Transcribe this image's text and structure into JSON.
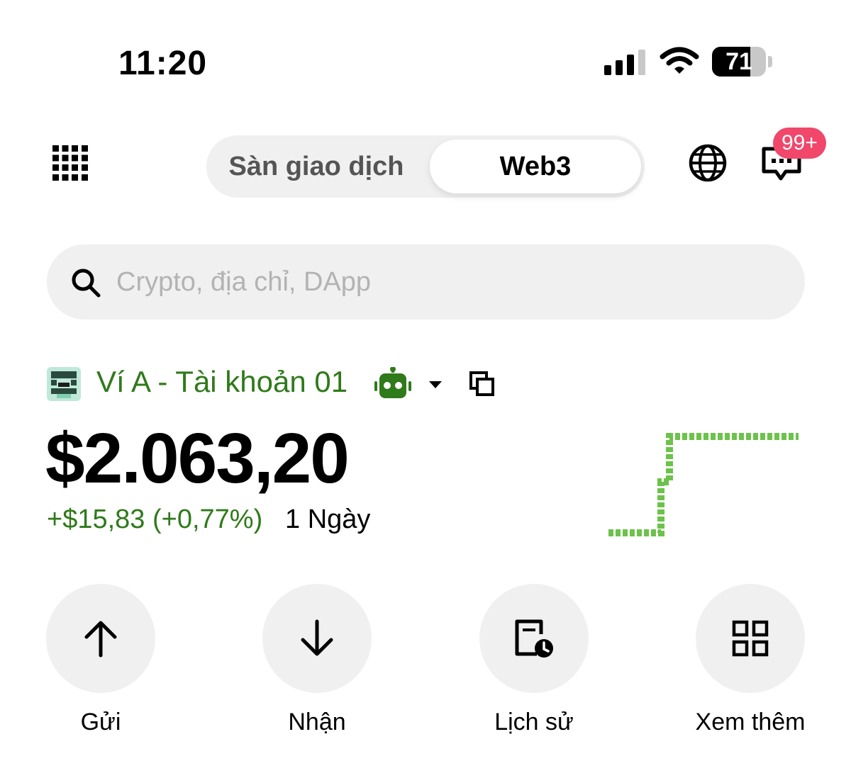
{
  "status_bar": {
    "time": "11:20",
    "battery_level": "71",
    "battery_fraction": 0.71,
    "icons": [
      "cellular-signal-icon",
      "wifi-icon",
      "battery-icon"
    ]
  },
  "header": {
    "menu_icon": "grid-menu-icon",
    "tabs": [
      {
        "label": "Sàn giao dịch",
        "selected": false
      },
      {
        "label": "Web3",
        "selected": true
      }
    ],
    "globe_icon": "globe-icon",
    "chat_icon": "chat-icon",
    "notification_badge": "99+"
  },
  "search": {
    "placeholder": "Crypto, địa chỉ, DApp",
    "value": ""
  },
  "wallet": {
    "name": "Ví A - Tài khoản 01",
    "balance": "$2.063,20",
    "change": "+$15,83 (+0,77%)",
    "period": "1 Ngày",
    "accent_color": "#2f7a1a"
  },
  "actions": [
    {
      "label": "Gửi",
      "icon": "arrow-up-icon"
    },
    {
      "label": "Nhận",
      "icon": "arrow-down-icon"
    },
    {
      "label": "Lịch sử",
      "icon": "history-icon"
    },
    {
      "label": "Xem thêm",
      "icon": "more-grid-icon"
    }
  ],
  "colors": {
    "accent_green": "#2f7a1a",
    "sparkline_green": "#6cc24a",
    "badge_red": "#f0476b",
    "surface": "#f0f0f0"
  }
}
